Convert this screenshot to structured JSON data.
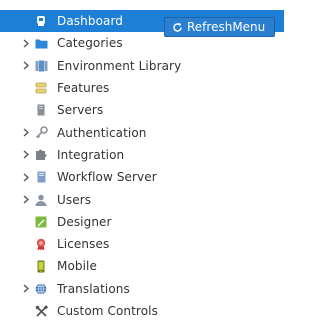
{
  "nav": {
    "items": [
      {
        "label": "Dashboard",
        "icon": "dashboard-icon",
        "expandable": false,
        "active": true
      },
      {
        "label": "Categories",
        "icon": "folder-icon",
        "expandable": true
      },
      {
        "label": "Environment Library",
        "icon": "environment-library-icon",
        "expandable": true
      },
      {
        "label": "Features",
        "icon": "features-icon",
        "expandable": false
      },
      {
        "label": "Servers",
        "icon": "server-icon",
        "expandable": false
      },
      {
        "label": "Authentication",
        "icon": "key-icon",
        "expandable": true
      },
      {
        "label": "Integration",
        "icon": "puzzle-icon",
        "expandable": true
      },
      {
        "label": "Workflow Server",
        "icon": "workflow-server-icon",
        "expandable": true
      },
      {
        "label": "Users",
        "icon": "user-icon",
        "expandable": true
      },
      {
        "label": "Designer",
        "icon": "designer-icon",
        "expandable": false
      },
      {
        "label": "Licenses",
        "icon": "license-ribbon-icon",
        "expandable": false
      },
      {
        "label": "Mobile",
        "icon": "mobile-icon",
        "expandable": false
      },
      {
        "label": "Translations",
        "icon": "globe-icon",
        "expandable": true
      },
      {
        "label": "Custom Controls",
        "icon": "tools-icon",
        "expandable": false
      }
    ]
  },
  "toolbar": {
    "refresh_label": "RefreshMenu",
    "refresh_icon": "refresh-icon"
  },
  "colors": {
    "active_background": "#1e7fd6",
    "button_background": "#2a7fd0"
  }
}
